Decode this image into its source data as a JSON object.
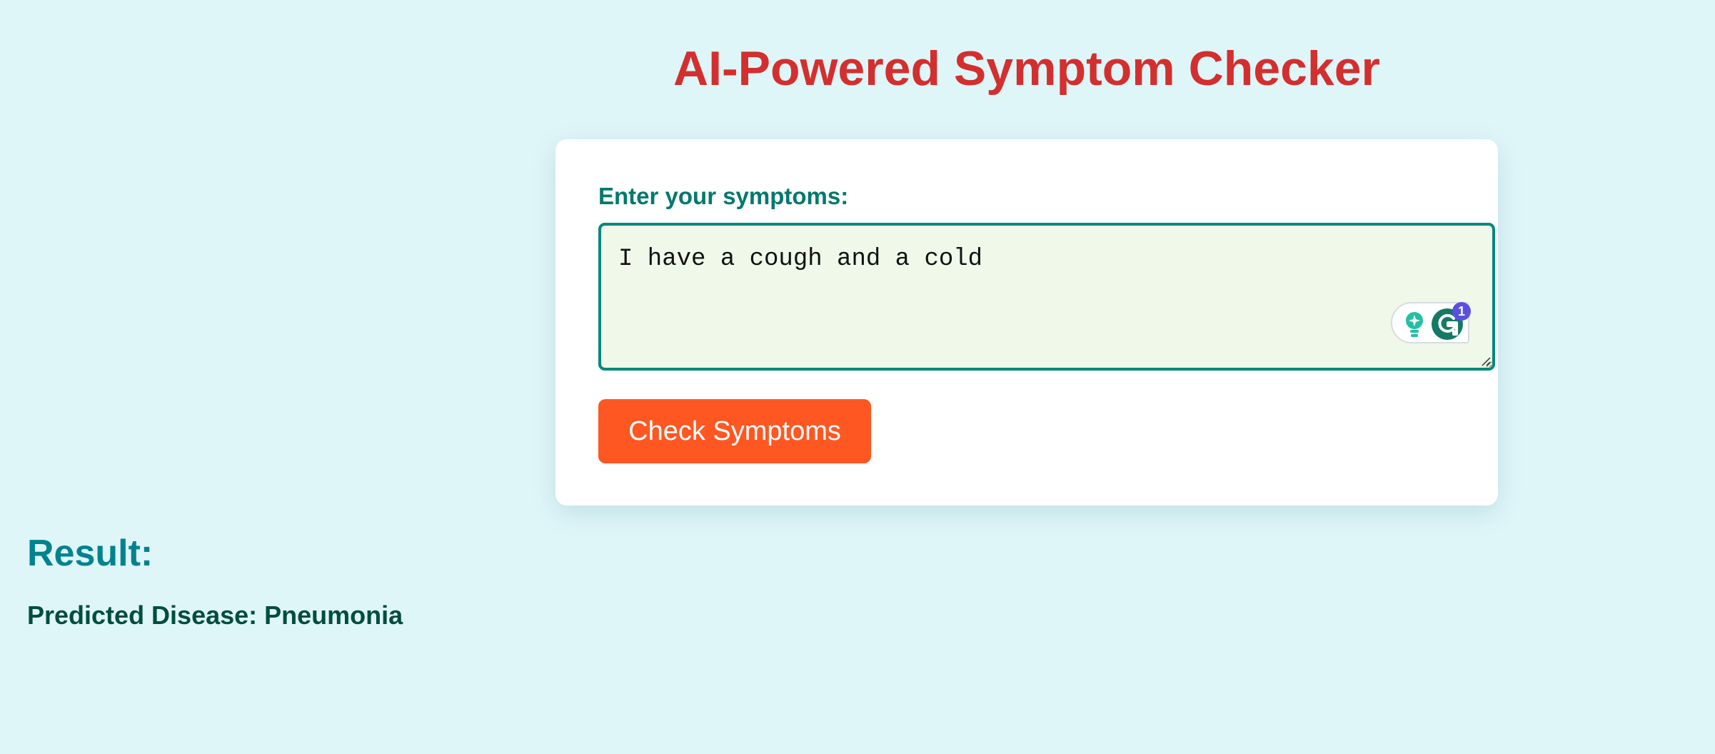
{
  "page": {
    "title": "AI-Powered Symptom Checker"
  },
  "form": {
    "label": "Enter your symptoms:",
    "symptoms_value": "I have a cough and a cold",
    "submit_label": "Check Symptoms"
  },
  "grammarly": {
    "badge_count": "1",
    "icons": [
      "lightbulb-icon",
      "grammarly-icon"
    ]
  },
  "result": {
    "heading": "Result:",
    "text": "Predicted Disease: Pneumonia"
  },
  "colors": {
    "background": "#dff6f9",
    "title": "#d32f2f",
    "label": "#00796b",
    "textarea_border": "#00897b",
    "textarea_bg": "#eff8e9",
    "button": "#ff5722",
    "result_heading": "#00838f",
    "result_text": "#004d40"
  }
}
